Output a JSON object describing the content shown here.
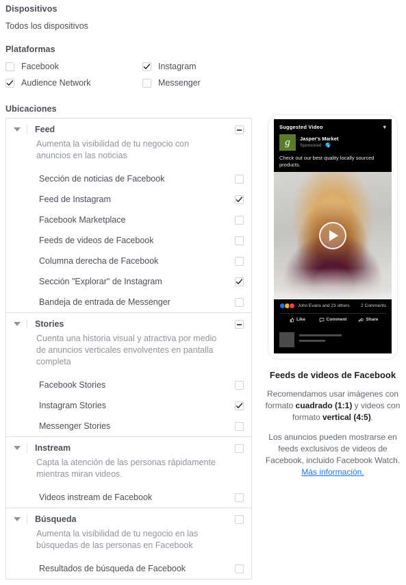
{
  "devices": {
    "label": "Dispositivos",
    "value": "Todos los dispositivos"
  },
  "platforms": {
    "label": "Plataformas",
    "items": [
      {
        "label": "Facebook",
        "checked": false
      },
      {
        "label": "Instagram",
        "checked": true
      },
      {
        "label": "Audience Network",
        "checked": true
      },
      {
        "label": "Messenger",
        "checked": false
      }
    ]
  },
  "placements": {
    "label": "Ubicaciones",
    "groups": [
      {
        "title": "Feed",
        "description": "Aumenta la visibilidad de tu negocio con anuncios en las noticias",
        "state": "indeterminate",
        "options": [
          {
            "label": "Sección de noticias de Facebook",
            "checked": false
          },
          {
            "label": "Feed de Instagram",
            "checked": true
          },
          {
            "label": "Facebook Marketplace",
            "checked": false
          },
          {
            "label": "Feeds de videos de Facebook",
            "checked": false
          },
          {
            "label": "Columna derecha de Facebook",
            "checked": false
          },
          {
            "label": "Sección \"Explorar\" de Instagram",
            "checked": true
          },
          {
            "label": "Bandeja de entrada de Messenger",
            "checked": false
          }
        ]
      },
      {
        "title": "Stories",
        "description": "Cuenta una historia visual y atractiva por medio de anuncios verticales envolventes en pantalla completa",
        "state": "indeterminate",
        "options": [
          {
            "label": "Facebook Stories",
            "checked": false
          },
          {
            "label": "Instagram Stories",
            "checked": true
          },
          {
            "label": "Messenger Stories",
            "checked": false
          }
        ]
      },
      {
        "title": "Instream",
        "description": "Capta la atención de las personas rápidamente mientras miran videos.",
        "state": "unchecked",
        "options": [
          {
            "label": "Videos instream de Facebook",
            "checked": false
          }
        ]
      },
      {
        "title": "Búsqueda",
        "description": "Aumenta la visibilidad de tu negocio en las búsquedas de las personas en Facebook",
        "state": "unchecked",
        "options": [
          {
            "label": "Resultados de búsqueda de Facebook",
            "checked": false
          }
        ]
      }
    ]
  },
  "preview": {
    "ad": {
      "suggested_label": "Suggested Video",
      "brand_initial": "g",
      "brand_name": "Jasper's Market",
      "sponsored": "Sponsored · ",
      "copy": "Check out our best quality locally sourced products.",
      "reactions_text": "John Evans and 23 others",
      "comments_text": "2 Comments",
      "actions": [
        {
          "label": "Like",
          "icon": "thumbs-up-icon"
        },
        {
          "label": "Comment",
          "icon": "comment-bubble-icon"
        },
        {
          "label": "Share",
          "icon": "share-arrow-icon"
        }
      ]
    },
    "caption": {
      "title": "Feeds de videos de Facebook",
      "para1_a": "Recomendamos usar imágenes con formato ",
      "para1_b": "cuadrado (1:1)",
      "para1_c": " y videos con formato ",
      "para1_d": "vertical (4:5)",
      "para1_e": ".",
      "para2_a": "Los anuncios pueden mostrarse en feeds exclusivos de videos de Facebook, incluido Facebook Watch. ",
      "para2_link": "Más información."
    }
  },
  "colors": {
    "text": "#4b4f56",
    "muted": "#90949c",
    "border": "#dddfe2",
    "link": "#2477f2",
    "brand_green": "#5b7d2a"
  }
}
